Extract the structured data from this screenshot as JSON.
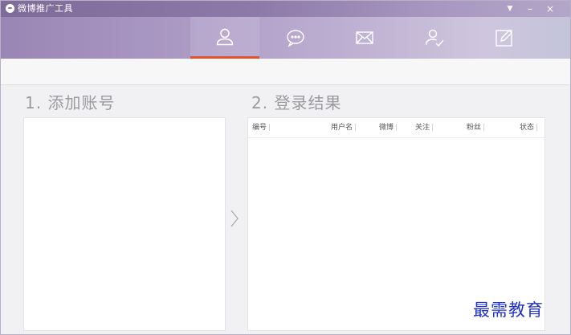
{
  "window": {
    "title": "微博推广工具",
    "controls": {
      "menu": "▼",
      "minimize": "–",
      "close": "×"
    }
  },
  "nav": {
    "tabs": [
      {
        "name": "account",
        "icon": "user-icon",
        "active": true
      },
      {
        "name": "message",
        "icon": "chat-bubble-icon",
        "active": false
      },
      {
        "name": "mail",
        "icon": "envelope-icon",
        "active": false
      },
      {
        "name": "user-check",
        "icon": "user-check-icon",
        "active": false
      },
      {
        "name": "edit",
        "icon": "edit-icon",
        "active": false
      }
    ],
    "active_color": "#e2532d"
  },
  "sections": {
    "add_account": {
      "title": "1. 添加账号"
    },
    "login_result": {
      "title": "2. 登录结果",
      "columns": [
        "编号",
        "用户名",
        "微博",
        "关注",
        "粉丝",
        "状态"
      ]
    }
  },
  "watermark": "最需教育"
}
